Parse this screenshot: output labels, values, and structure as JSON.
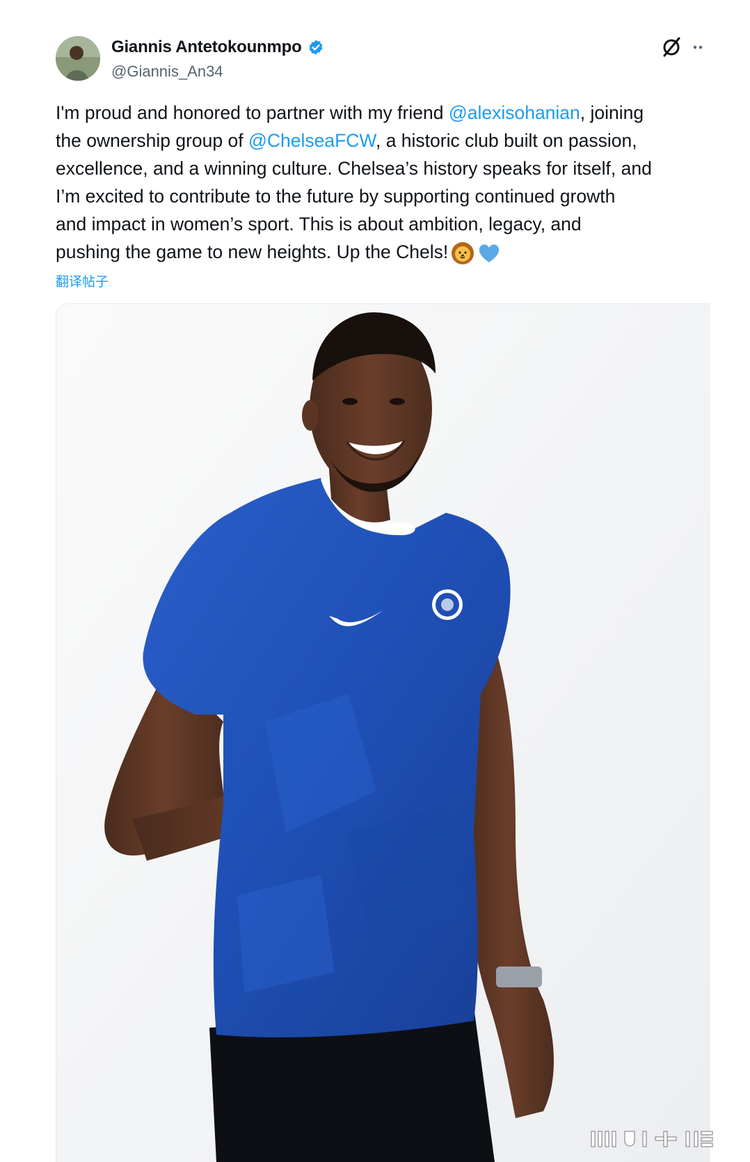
{
  "author": {
    "name": "Giannis Antetokounmpo",
    "handle": "@Giannis_An34",
    "verified": true
  },
  "post": {
    "lines": [
      {
        "pre": "I'm proud and honored to partner with my friend ",
        "mention": "@alexisohanian",
        "post": ", joining"
      },
      {
        "pre": "the ownership group of ",
        "mention": "@ChelseaFCW",
        "post": ", a historic club built on passion,"
      },
      {
        "pre": "excellence, and a winning culture. Chelsea’s history speaks for itself, and",
        "mention": "",
        "post": ""
      },
      {
        "pre": "I’m excited to contribute to the future by supporting continued growth",
        "mention": "",
        "post": ""
      },
      {
        "pre": "and impact in women’s sport. This is about ambition, legacy, and",
        "mention": "",
        "post": ""
      },
      {
        "pre": "pushing the game to new heights. Up the Chels!",
        "mention": "",
        "post": ""
      }
    ],
    "emojis": [
      "lion-face-emoji",
      "blue-heart-emoji"
    ],
    "translate_label": "翻译帖子"
  },
  "colors": {
    "accent": "#1d9bf0",
    "text": "#0f1419",
    "muted": "#536471",
    "jersey": "#1f4fb5"
  },
  "icons": [
    "verified-badge-icon",
    "grok-icon",
    "more-icon"
  ]
}
